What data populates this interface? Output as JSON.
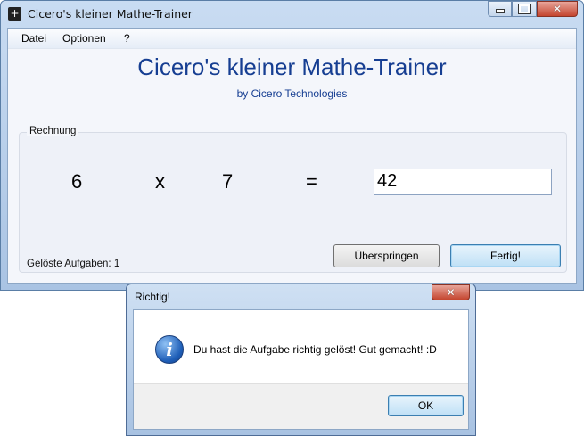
{
  "window": {
    "title": "Cicero's kleiner Mathe-Trainer",
    "app_icon": "+"
  },
  "caption_buttons": {
    "close_glyph": "✕"
  },
  "menu": [
    {
      "label": "Datei"
    },
    {
      "label": "Optionen"
    },
    {
      "label": "?"
    }
  ],
  "header": {
    "title": "Cicero's kleiner Mathe-Trainer",
    "subtitle": "by Cicero Technologies",
    "color": "#163e92"
  },
  "exercise": {
    "group_label": "Rechnung",
    "operand1": "6",
    "operator": "x",
    "operand2": "7",
    "equals": "=",
    "answer_value": "42",
    "solved_label": "Gelöste Aufgaben: 1"
  },
  "buttons": {
    "skip": "Überspringen",
    "done": "Fertig!"
  },
  "dialog": {
    "title": "Richtig!",
    "icon": "info-icon",
    "icon_glyph": "i",
    "message": "Du hast die Aufgabe richtig gelöst! Gut gemacht!  :D",
    "ok": "OK"
  }
}
